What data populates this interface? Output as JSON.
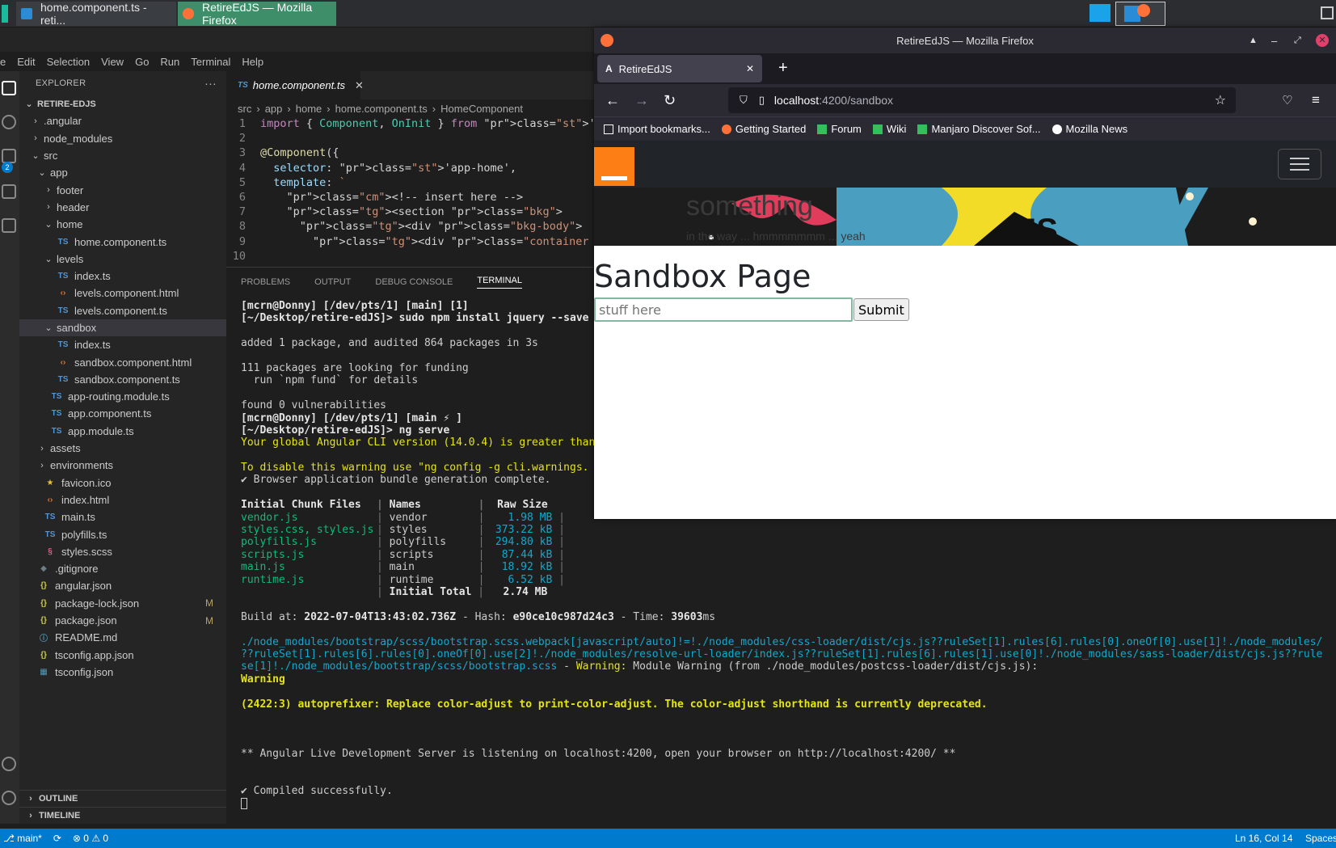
{
  "taskbar": {
    "vscode_task": "home.component.ts - reti...",
    "firefox_task": "RetireEdJS — Mozilla Firefox"
  },
  "menu": [
    "Edit",
    "Selection",
    "View",
    "Go",
    "Run",
    "Terminal",
    "Help"
  ],
  "explorer": {
    "title": "EXPLORER",
    "more": "···",
    "root": "RETIRE-EDJS",
    "items": [
      {
        "label": ".angular",
        "depth": 1,
        "kind": "folder",
        "open": false
      },
      {
        "label": "node_modules",
        "depth": 1,
        "kind": "folder",
        "open": false
      },
      {
        "label": "src",
        "depth": 1,
        "kind": "folder",
        "open": true
      },
      {
        "label": "app",
        "depth": 2,
        "kind": "folder",
        "open": true
      },
      {
        "label": "footer",
        "depth": 3,
        "kind": "folder",
        "open": false
      },
      {
        "label": "header",
        "depth": 3,
        "kind": "folder",
        "open": false
      },
      {
        "label": "home",
        "depth": 3,
        "kind": "folder",
        "open": true
      },
      {
        "label": "home.component.ts",
        "depth": 4,
        "kind": "ts"
      },
      {
        "label": "levels",
        "depth": 3,
        "kind": "folder",
        "open": true
      },
      {
        "label": "index.ts",
        "depth": 4,
        "kind": "ts"
      },
      {
        "label": "levels.component.html",
        "depth": 4,
        "kind": "html"
      },
      {
        "label": "levels.component.ts",
        "depth": 4,
        "kind": "ts"
      },
      {
        "label": "sandbox",
        "depth": 3,
        "kind": "folder",
        "open": true,
        "selected": true
      },
      {
        "label": "index.ts",
        "depth": 4,
        "kind": "ts"
      },
      {
        "label": "sandbox.component.html",
        "depth": 4,
        "kind": "html"
      },
      {
        "label": "sandbox.component.ts",
        "depth": 4,
        "kind": "ts"
      },
      {
        "label": "app-routing.module.ts",
        "depth": 3,
        "kind": "ts"
      },
      {
        "label": "app.component.ts",
        "depth": 3,
        "kind": "ts"
      },
      {
        "label": "app.module.ts",
        "depth": 3,
        "kind": "ts"
      },
      {
        "label": "assets",
        "depth": 2,
        "kind": "folder",
        "open": false
      },
      {
        "label": "environments",
        "depth": 2,
        "kind": "folder",
        "open": false
      },
      {
        "label": "favicon.ico",
        "depth": 2,
        "kind": "star"
      },
      {
        "label": "index.html",
        "depth": 2,
        "kind": "html"
      },
      {
        "label": "main.ts",
        "depth": 2,
        "kind": "ts"
      },
      {
        "label": "polyfills.ts",
        "depth": 2,
        "kind": "ts"
      },
      {
        "label": "styles.scss",
        "depth": 2,
        "kind": "scss"
      },
      {
        "label": ".gitignore",
        "depth": 1,
        "kind": "git"
      },
      {
        "label": "angular.json",
        "depth": 1,
        "kind": "json"
      },
      {
        "label": "package-lock.json",
        "depth": 1,
        "kind": "json",
        "badge": "M"
      },
      {
        "label": "package.json",
        "depth": 1,
        "kind": "json",
        "badge": "M"
      },
      {
        "label": "README.md",
        "depth": 1,
        "kind": "md"
      },
      {
        "label": "tsconfig.app.json",
        "depth": 1,
        "kind": "json"
      },
      {
        "label": "tsconfig.json",
        "depth": 1,
        "kind": "tscfg"
      }
    ],
    "outline": "OUTLINE",
    "timeline": "TIMELINE"
  },
  "editor": {
    "tab": "home.component.ts",
    "tab_prefix": "TS",
    "breadcrumbs": [
      "src",
      "app",
      "home",
      "home.component.ts",
      "HomeComponent"
    ],
    "lines": [
      {
        "n": "1",
        "t": "import { Component, OnInit } from '@angular/core';"
      },
      {
        "n": "2",
        "t": ""
      },
      {
        "n": "3",
        "t": "@Component({"
      },
      {
        "n": "4",
        "t": "  selector: 'app-home',"
      },
      {
        "n": "5",
        "t": "  template: `"
      },
      {
        "n": "6",
        "t": "    <!-- insert here -->"
      },
      {
        "n": "7",
        "t": "    <section class=\"bkg\">"
      },
      {
        "n": "8",
        "t": "      <div class=\"bkg-body\">"
      },
      {
        "n": "9",
        "t": "        <div class=\"container has-text-centered"
      },
      {
        "n": "10",
        "t": ""
      }
    ]
  },
  "panel": {
    "tabs": [
      "PROBLEMS",
      "OUTPUT",
      "DEBUG CONSOLE",
      "TERMINAL"
    ],
    "terminal": {
      "prompt1": "[mcrn@Donny] [/dev/pts/1] [main] [1]",
      "cmd1": "[~/Desktop/retire-edJS]> sudo npm install jquery --save",
      "added": "added 1 package, and audited 864 packages in 3s",
      "funding1": "111 packages are looking for funding",
      "funding2": "  run `npm fund` for details",
      "found": "found 0 vulnerabilities",
      "prompt2": "[mcrn@Donny] [/dev/pts/1] [main ⚡ ]",
      "cmd2": "[~/Desktop/retire-edJS]> ng serve",
      "warn1": "Your global Angular CLI version (14.0.4) is greater than",
      "warn2": "To disable this warning use \"ng config -g cli.warnings.",
      "bundle": "✔ Browser application bundle generation complete.",
      "table_head": [
        "Initial Chunk Files",
        "Names",
        "Raw Size"
      ],
      "table_rows": [
        [
          "vendor.js",
          "vendor",
          "1.98 MB"
        ],
        [
          "styles.css, styles.js",
          "styles",
          "373.22 kB"
        ],
        [
          "polyfills.js",
          "polyfills",
          "294.80 kB"
        ],
        [
          "scripts.js",
          "scripts",
          "87.44 kB"
        ],
        [
          "main.js",
          "main",
          "18.92 kB"
        ],
        [
          "runtime.js",
          "runtime",
          "6.52 kB"
        ]
      ],
      "total_label": "Initial Total",
      "total_value": "2.74 MB",
      "build_at": "Build at: ",
      "build_time": "2022-07-04T13:43:02.736Z",
      "hash_label": " - Hash: ",
      "hash": "e90ce10c987d24c3",
      "time_label": " - Time: ",
      "time": "39603",
      "ms": "ms",
      "path1": "./node_modules/bootstrap/scss/bootstrap.scss.webpack[javascript/auto]!=!./node_modules/css-loader/dist/cjs.js??ruleSet[1].rules[6].rules[0].oneOf[0].use[1]!./node_modules/",
      "path2": "??ruleSet[1].rules[6].rules[0].oneOf[0].use[2]!./node_modules/resolve-url-loader/index.js??ruleSet[1].rules[6].rules[1].use[0]!./node_modules/sass-loader/dist/cjs.js??rule",
      "path3a": "se[1]!./node_modules/bootstrap/scss/bootstrap.scss",
      "path3b": " - ",
      "path3c": "Warning: ",
      "path3d": "Module Warning (from ./node_modules/postcss-loader/dist/cjs.js):",
      "warning": "Warning",
      "autoprefixer": "(2422:3) autoprefixer: Replace color-adjust to print-color-adjust. The color-adjust shorthand is currently deprecated.",
      "listening": "** Angular Live Development Server is listening on localhost:4200, open your browser on http://localhost:4200/ **",
      "compiled": "✔ Compiled successfully."
    }
  },
  "statusbar": {
    "branch": "main*",
    "sync": "⟳",
    "errors": "⊗ 0 ⚠ 0",
    "position": "Ln 16, Col 14",
    "spaces": "Spaces"
  },
  "firefox": {
    "window_title": "RetireEdJS — Mozilla Firefox",
    "tab_title": "RetireEdJS",
    "new_tab": "+",
    "url_host": "localhost",
    "url_path": ":4200/sandbox",
    "bookmarks": [
      "Import bookmarks...",
      "Getting Started",
      "Forum",
      "Wiki",
      "Manjaro Discover Sof...",
      "Mozilla News"
    ],
    "page": {
      "hero_title": "something",
      "hero_sub": "in the way ... hmmmmmmm ... yeah",
      "heading": "Sandbox Page",
      "input_placeholder": "stuff here",
      "submit": "Submit"
    }
  },
  "colors": {
    "accent": "#007acc",
    "firefox_task": "#3e8e6a",
    "brand_orange": "#fd7e14"
  }
}
